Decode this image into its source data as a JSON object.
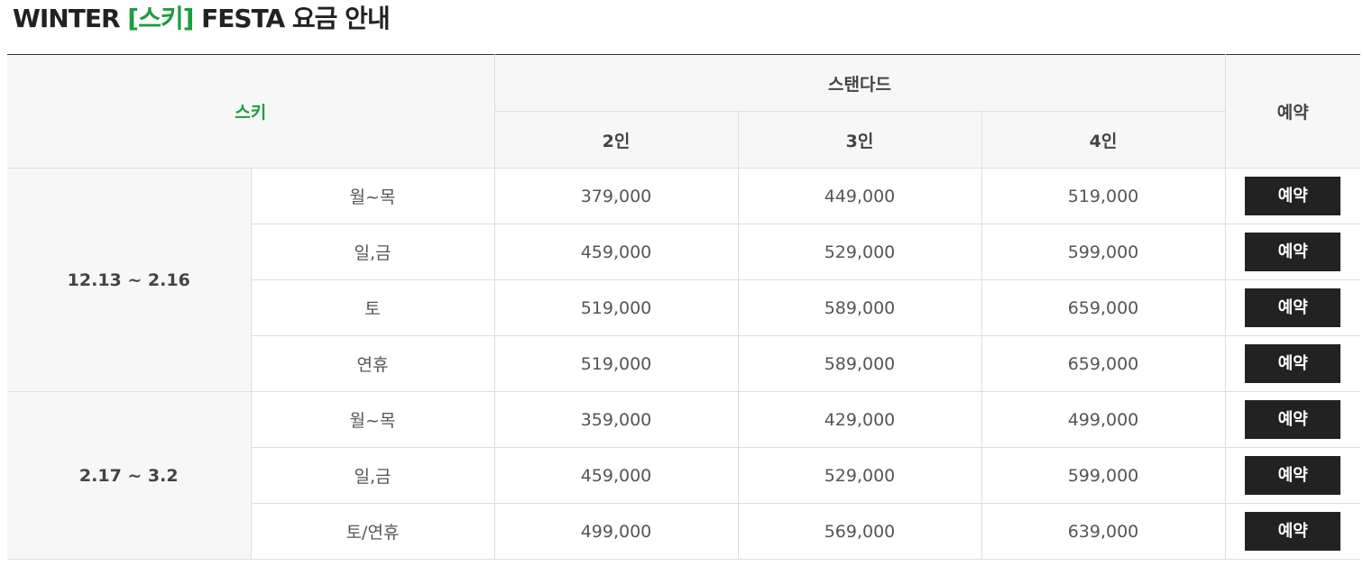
{
  "title": {
    "prefix": "WINTER ",
    "accent": "[스키]",
    "suffix": " FESTA 요금 안내"
  },
  "colors": {
    "accent": "#1a9e3f",
    "button_bg": "#222222",
    "header_bg": "#f7f7f7"
  },
  "table": {
    "header": {
      "category": "스키",
      "group": "스탠다드",
      "reserve": "예약",
      "persons": [
        "2인",
        "3인",
        "4인"
      ]
    },
    "periods": [
      {
        "label": "12.13 ~ 2.16",
        "rows": [
          {
            "day": "월~목",
            "prices": [
              "379,000",
              "449,000",
              "519,000"
            ],
            "button": "예약"
          },
          {
            "day": "일,금",
            "prices": [
              "459,000",
              "529,000",
              "599,000"
            ],
            "button": "예약"
          },
          {
            "day": "토",
            "prices": [
              "519,000",
              "589,000",
              "659,000"
            ],
            "button": "예약"
          },
          {
            "day": "연휴",
            "prices": [
              "519,000",
              "589,000",
              "659,000"
            ],
            "button": "예약"
          }
        ]
      },
      {
        "label": "2.17 ~ 3.2",
        "rows": [
          {
            "day": "월~목",
            "prices": [
              "359,000",
              "429,000",
              "499,000"
            ],
            "button": "예약"
          },
          {
            "day": "일,금",
            "prices": [
              "459,000",
              "529,000",
              "599,000"
            ],
            "button": "예약"
          },
          {
            "day": "토/연휴",
            "prices": [
              "499,000",
              "569,000",
              "639,000"
            ],
            "button": "예약"
          }
        ]
      }
    ]
  }
}
